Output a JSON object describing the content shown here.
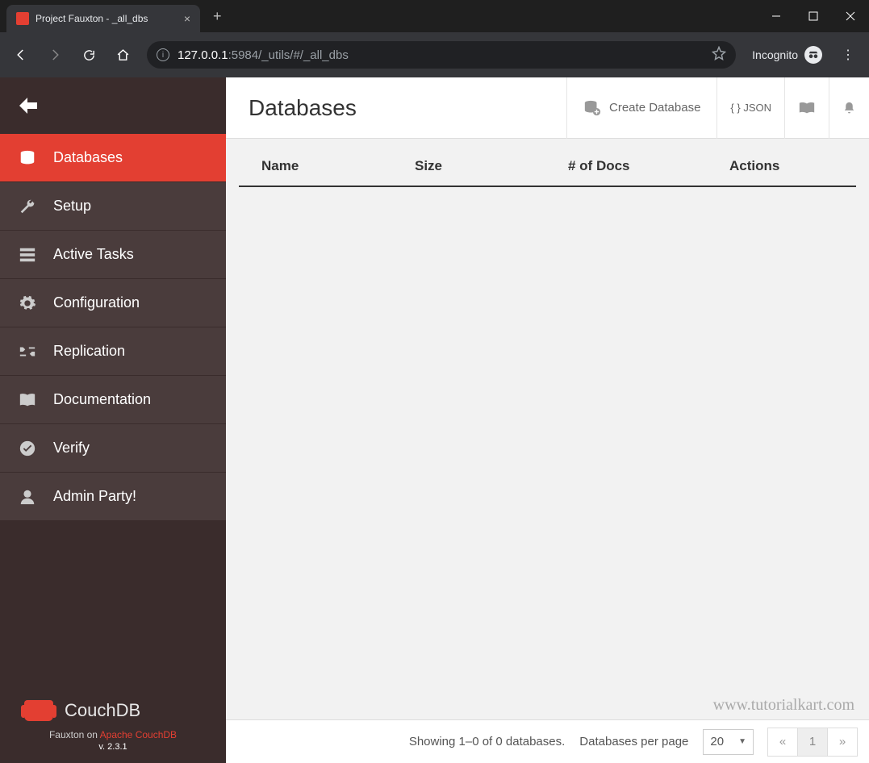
{
  "browser": {
    "tab_title": "Project Fauxton - _all_dbs",
    "url_prefix": "127.0.0.1",
    "url_suffix": ":5984/_utils/#/_all_dbs",
    "incognito_label": "Incognito"
  },
  "sidebar": {
    "items": [
      {
        "label": "Databases"
      },
      {
        "label": "Setup"
      },
      {
        "label": "Active Tasks"
      },
      {
        "label": "Configuration"
      },
      {
        "label": "Replication"
      },
      {
        "label": "Documentation"
      },
      {
        "label": "Verify"
      },
      {
        "label": "Admin Party!"
      }
    ],
    "brand": "CouchDB",
    "footer_prefix": "Fauxton on ",
    "footer_link": "Apache CouchDB",
    "version": "v. 2.3.1"
  },
  "header": {
    "title": "Databases",
    "create_label": "Create Database",
    "json_label": "{ } JSON"
  },
  "table": {
    "col_name": "Name",
    "col_size": "Size",
    "col_docs": "# of Docs",
    "col_actions": "Actions"
  },
  "pager": {
    "showing": "Showing 1–0 of 0 databases.",
    "per_page_label": "Databases per page",
    "per_page_value": "20",
    "prev": "«",
    "page": "1",
    "next": "»"
  },
  "watermark": "www.tutorialkart.com"
}
